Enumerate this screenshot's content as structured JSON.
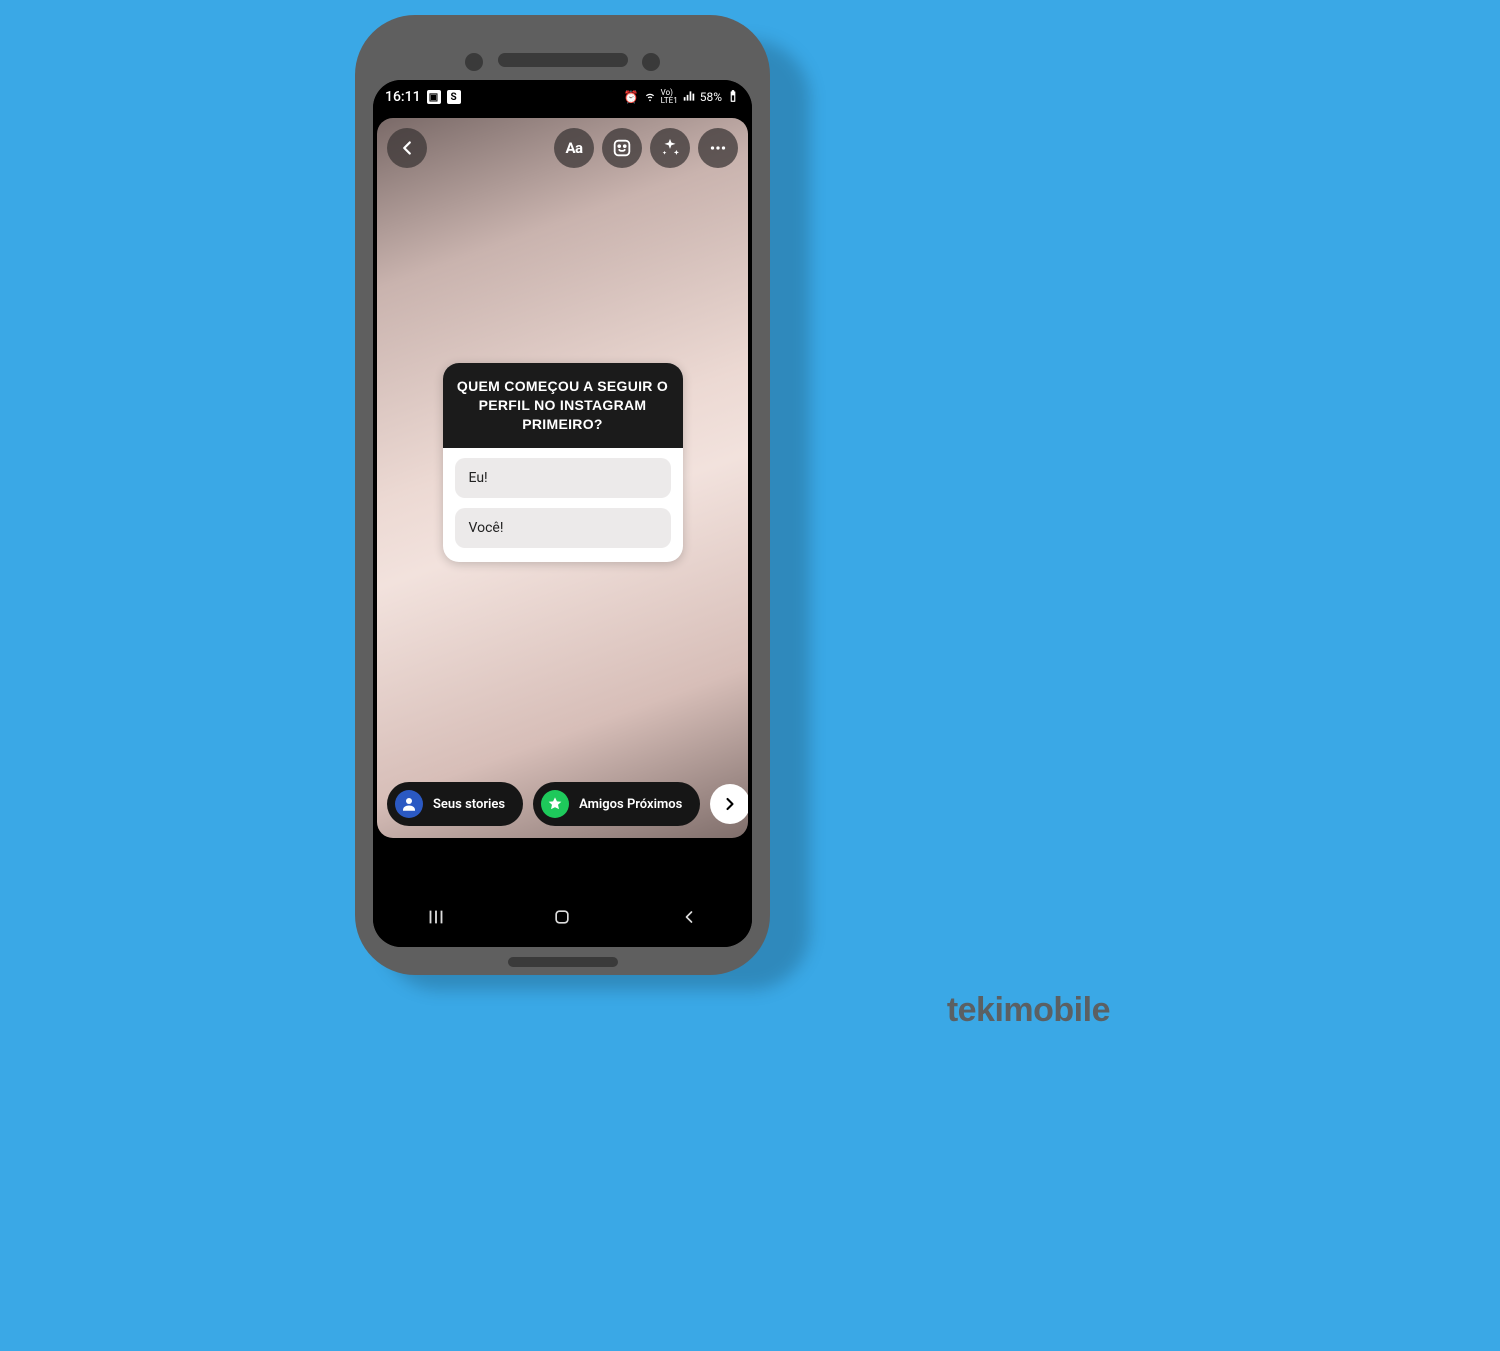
{
  "status": {
    "time": "16:11",
    "battery": "58%",
    "lte": "LTE1",
    "vo": "Vo)"
  },
  "toolbar": {
    "text_label": "Aa"
  },
  "quiz": {
    "question": "QUEM COMEÇOU A SEGUIR O PERFIL NO INSTAGRAM PRIMEIRO?",
    "options": [
      "Eu!",
      "Você!"
    ]
  },
  "share": {
    "your_stories": "Seus stories",
    "close_friends": "Amigos Próximos"
  },
  "watermark": "tekimobile"
}
